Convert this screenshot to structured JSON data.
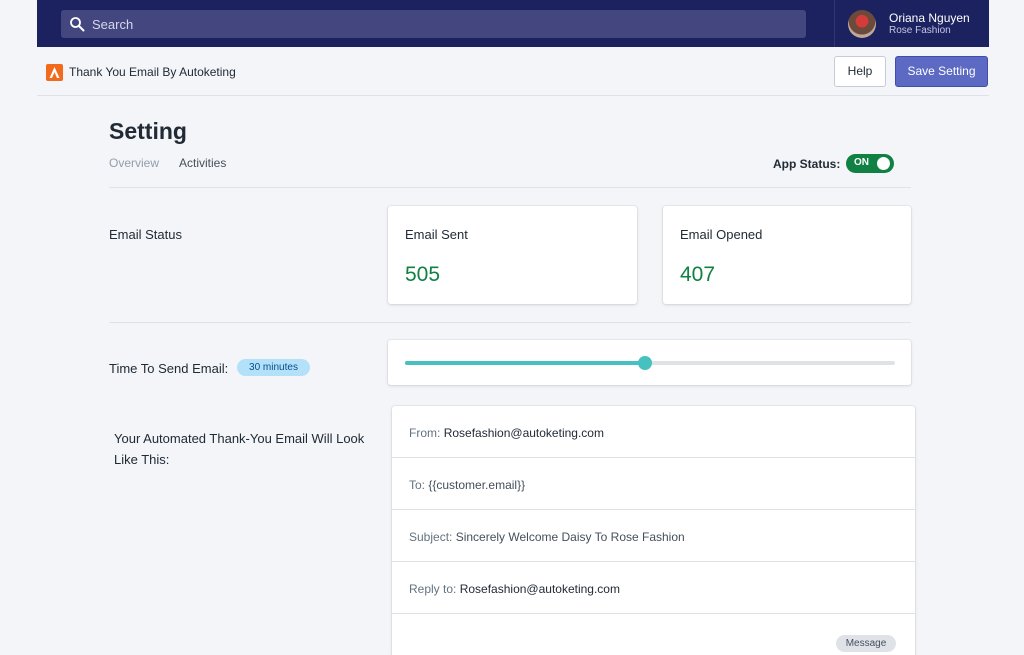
{
  "topbar": {
    "search_placeholder": "Search",
    "user": {
      "name": "Oriana Nguyen",
      "store": "Rose Fashion"
    }
  },
  "appbar": {
    "title": "Thank You Email By Autoketing",
    "help_label": "Help",
    "save_label": "Save Setting"
  },
  "page": {
    "title": "Setting",
    "tabs": [
      {
        "label": "Overview",
        "active": false
      },
      {
        "label": "Activities",
        "active": true
      }
    ],
    "app_status": {
      "label": "App Status:",
      "value": "ON",
      "on": true
    }
  },
  "email_status": {
    "label": "Email Status",
    "cards": [
      {
        "label": "Email Sent",
        "value": "505"
      },
      {
        "label": "Email Opened",
        "value": "407"
      }
    ]
  },
  "time_to_send": {
    "label": "Time To Send Email:",
    "badge": "30 minutes",
    "slider_fraction": 0.49
  },
  "preview": {
    "label": "Your Automated Thank-You Email Will Look Like This:",
    "rows": [
      {
        "key": "From:",
        "value": "Rosefashion@autoketing.com"
      },
      {
        "key": "To:",
        "value": "{{customer.email}}"
      },
      {
        "key": "Subject:",
        "value": "Sincerely Welcome Daisy To Rose Fashion"
      },
      {
        "key": "Reply to:",
        "value": "Rosefashion@autoketing.com"
      }
    ],
    "message_tag": "Message"
  },
  "colors": {
    "topbar": "#1c2260",
    "primary_button": "#5c6ac4",
    "success": "#108043",
    "slider": "#47c1bf",
    "badge": "#b4e1fa"
  }
}
